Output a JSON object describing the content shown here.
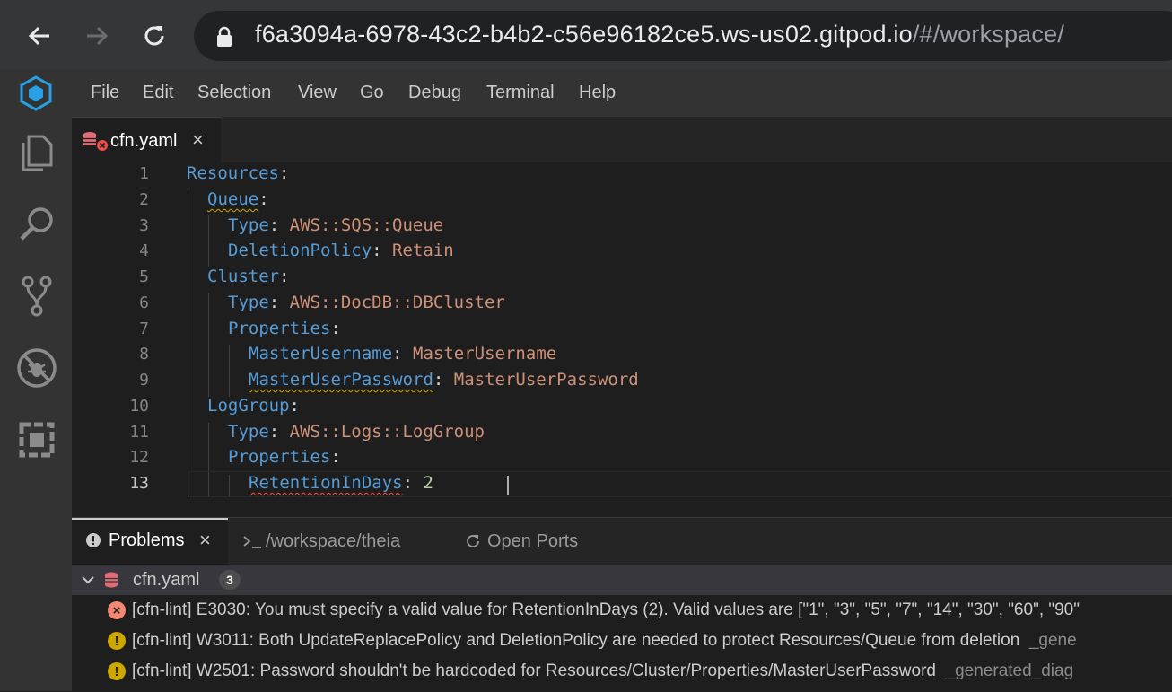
{
  "browser": {
    "url_host": "f6a3094a-6978-43c2-b4b2-c56e96182ce5.ws-us02.gitpod.io",
    "url_path": "/#/workspace/"
  },
  "menu": [
    "File",
    "Edit",
    "Selection",
    "View",
    "Go",
    "Debug",
    "Terminal",
    "Help"
  ],
  "activity_icons": [
    "files-icon",
    "search-icon",
    "source-control-icon",
    "debug-icon",
    "extensions-icon"
  ],
  "editor": {
    "tab_label": "cfn.yaml",
    "tab_close": "×",
    "lines": [
      {
        "num": "1",
        "key": "Resources",
        "sep": ":",
        "val": ""
      },
      {
        "num": "2",
        "key": "Queue",
        "sep": ":",
        "val": ""
      },
      {
        "num": "3",
        "key": "Type",
        "sep": ": ",
        "val": "AWS::SQS::Queue"
      },
      {
        "num": "4",
        "key": "DeletionPolicy",
        "sep": ": ",
        "val": "Retain"
      },
      {
        "num": "5",
        "key": "Cluster",
        "sep": ":",
        "val": ""
      },
      {
        "num": "6",
        "key": "Type",
        "sep": ": ",
        "val": "AWS::DocDB::DBCluster"
      },
      {
        "num": "7",
        "key": "Properties",
        "sep": ":",
        "val": ""
      },
      {
        "num": "8",
        "key": "MasterUsername",
        "sep": ": ",
        "val": "MasterUsername"
      },
      {
        "num": "9",
        "key": "MasterUserPassword",
        "sep": ": ",
        "val": "MasterUserPassword"
      },
      {
        "num": "10",
        "key": "LogGroup",
        "sep": ":",
        "val": ""
      },
      {
        "num": "11",
        "key": "Type",
        "sep": ": ",
        "val": "AWS::Logs::LogGroup"
      },
      {
        "num": "12",
        "key": "Properties",
        "sep": ":",
        "val": ""
      },
      {
        "num": "13",
        "key": "RetentionInDays",
        "sep": ": ",
        "val": "2"
      }
    ]
  },
  "panel": {
    "tabs": {
      "problems": "Problems",
      "problems_close": "×",
      "terminal": "/workspace/theia",
      "ports": "Open Ports"
    },
    "file": "cfn.yaml",
    "count": "3",
    "problems": [
      {
        "severity": "error",
        "text": "[cfn-lint] E3030: You must specify a valid value for RetentionInDays (2). Valid values are [\"1\", \"3\", \"5\", \"7\", \"14\", \"30\", \"60\", \"90\"",
        "source": ""
      },
      {
        "severity": "warning",
        "text": "[cfn-lint] W3011: Both UpdateReplacePolicy and DeletionPolicy are needed to protect Resources/Queue from deletion",
        "source": "_gene"
      },
      {
        "severity": "warning",
        "text": "[cfn-lint] W2501: Password shouldn't be hardcoded for Resources/Cluster/Properties/MasterUserPassword",
        "source": "_generated_diag"
      }
    ]
  },
  "colors": {
    "error": "#f48771",
    "warning": "#cca700",
    "keyword": "#569cd6",
    "string": "#ce9178"
  }
}
